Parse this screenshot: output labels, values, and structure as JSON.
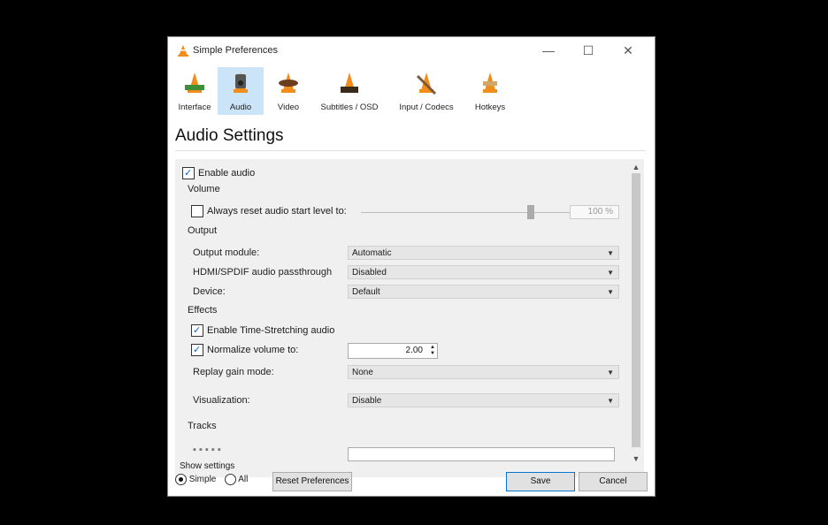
{
  "window": {
    "title": "Simple Preferences",
    "controls": {
      "minimize": "—",
      "maximize": "☐",
      "close": "✕"
    }
  },
  "tabs": [
    {
      "label": "Interface",
      "active": false
    },
    {
      "label": "Audio",
      "active": true
    },
    {
      "label": "Video",
      "active": false
    },
    {
      "label": "Subtitles / OSD",
      "active": false
    },
    {
      "label": "Input / Codecs",
      "active": false
    },
    {
      "label": "Hotkeys",
      "active": false
    }
  ],
  "page_title": "Audio Settings",
  "settings": {
    "enable_audio": {
      "label": "Enable audio",
      "checked": true
    },
    "volume_section": "Volume",
    "reset_level": {
      "label": "Always reset audio start level to:",
      "checked": false,
      "value": "100 %",
      "level": 0.85
    },
    "output_section": "Output",
    "output_module": {
      "label": "Output module:",
      "value": "Automatic"
    },
    "passthrough": {
      "label": "HDMI/SPDIF audio passthrough",
      "value": "Disabled"
    },
    "device": {
      "label": "Device:",
      "value": "Default"
    },
    "effects_section": "Effects",
    "time_stretch": {
      "label": "Enable Time-Stretching audio",
      "checked": true
    },
    "normalize": {
      "label": "Normalize volume to:",
      "checked": true,
      "value": "2.00"
    },
    "replay_gain": {
      "label": "Replay gain mode:",
      "value": "None"
    },
    "visualization": {
      "label": "Visualization:",
      "value": "Disable"
    },
    "tracks_section": "Tracks"
  },
  "bottom": {
    "show_settings": "Show settings",
    "simple": {
      "label": "Simple",
      "selected": true
    },
    "all": {
      "label": "All",
      "selected": false
    },
    "reset": "Reset Preferences",
    "save": "Save",
    "cancel": "Cancel"
  },
  "colors": {
    "active_tab": "#cce4f7",
    "cone_orange": "#f28c1b",
    "accent": "#0078d7"
  }
}
